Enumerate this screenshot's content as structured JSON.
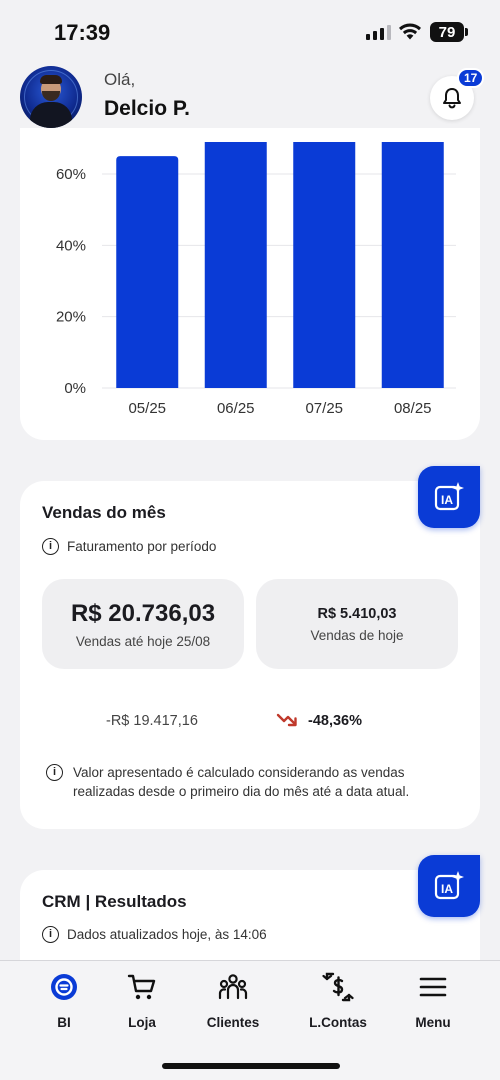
{
  "status_bar": {
    "time": "17:39",
    "battery": "79"
  },
  "header": {
    "greeting": "Olá,",
    "user_name": "Delcio P.",
    "notification_count": "17"
  },
  "chart_data": {
    "type": "bar",
    "categories": [
      "05/25",
      "06/25",
      "07/25",
      "08/25"
    ],
    "values": [
      65,
      70,
      70,
      70
    ],
    "yticks": [
      "0%",
      "20%",
      "40%",
      "60%"
    ],
    "ylim": [
      0,
      60
    ],
    "bar_color": "#0a3bd6",
    "grid": true
  },
  "sales_card": {
    "title": "Vendas do mês",
    "subtitle": "Faturamento por período",
    "main_value": "R$ 20.736,03",
    "main_label": "Vendas até hoje 25/08",
    "today_value": "R$ 5.410,03",
    "today_label": "Vendas de hoje",
    "diff_value": "-R$ 19.417,16",
    "diff_percent": "-48,36%",
    "note": "Valor apresentado é calculado considerando as vendas realizadas desde o primeiro dia do mês até a data atual."
  },
  "crm_card": {
    "title": "CRM | Resultados",
    "subtitle": "Dados atualizados hoje, às 14:06"
  },
  "ia_button": {
    "label": "IA"
  },
  "nav": [
    {
      "label": "BI",
      "icon": "bi-icon"
    },
    {
      "label": "Loja",
      "icon": "cart-icon"
    },
    {
      "label": "Clientes",
      "icon": "people-icon"
    },
    {
      "label": "L.Contas",
      "icon": "ledger-icon"
    },
    {
      "label": "Menu",
      "icon": "menu-icon"
    }
  ],
  "colors": {
    "accent": "#0a3bd6",
    "trend_down": "#c0392b"
  }
}
